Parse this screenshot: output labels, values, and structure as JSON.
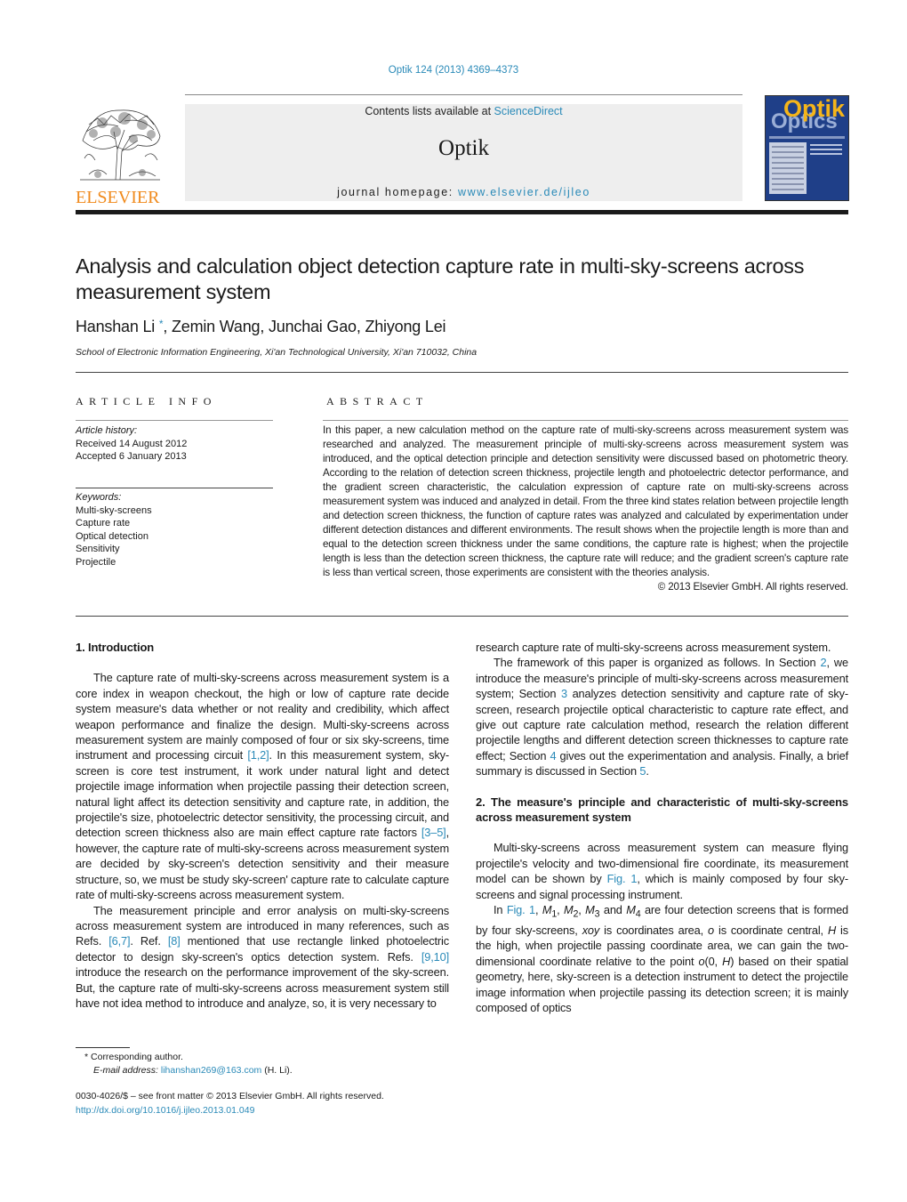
{
  "header": {
    "citation": "Optik 124 (2013) 4369–4373",
    "contents_prefix": "Contents lists available at ",
    "contents_link": "ScienceDirect",
    "journal_name": "Optik",
    "homepage_prefix": "journal homepage: ",
    "homepage_link": "www.elsevier.de/ijleo",
    "publisher_logo_text": "ELSEVIER",
    "cover_title_top": "Optik",
    "cover_title_bottom": "Optics"
  },
  "article": {
    "title": "Analysis and calculation object detection capture rate in multi-sky-screens across measurement system",
    "authors": [
      {
        "name": "Hanshan Li",
        "corresponding_mark": "*"
      },
      {
        "name": "Zemin Wang"
      },
      {
        "name": "Junchai Gao"
      },
      {
        "name": "Zhiyong Lei"
      }
    ],
    "affiliation": "School of Electronic Information Engineering, Xi'an Technological University, Xi'an 710032, China"
  },
  "article_info": {
    "heading": "ARTICLE INFO",
    "history_label": "Article history:",
    "received": "Received 14 August 2012",
    "accepted": "Accepted 6 January 2013",
    "keywords_label": "Keywords:",
    "keywords": [
      "Multi-sky-screens",
      "Capture rate",
      "Optical detection",
      "Sensitivity",
      "Projectile"
    ]
  },
  "abstract": {
    "heading": "ABSTRACT",
    "text": "In this paper, a new calculation method on the capture rate of multi-sky-screens across measurement system was researched and analyzed. The measurement principle of multi-sky-screens across measurement system was introduced, and the optical detection principle and detection sensitivity were discussed based on photometric theory. According to the relation of detection screen thickness, projectile length and photoelectric detector performance, and the gradient screen characteristic, the calculation expression of capture rate on multi-sky-screens across measurement system was induced and analyzed in detail. From the three kind states relation between projectile length and detection screen thickness, the function of capture rates was analyzed and calculated by experimentation under different detection distances and different environments. The result shows when the projectile length is more than and equal to the detection screen thickness under the same conditions, the capture rate is highest; when the projectile length is less than the detection screen thickness, the capture rate will reduce; and the gradient screen's capture rate is less than vertical screen, those experiments are consistent with the theories analysis.",
    "copyright": "© 2013 Elsevier GmbH. All rights reserved."
  },
  "body": {
    "sec1_heading": "1.  Introduction",
    "p1_a": "The capture rate of multi-sky-screens across measurement system is a core index in weapon checkout, the high or low of capture rate decide system measure's data whether or not reality and credibility, which affect weapon performance and finalize the design. Multi-sky-screens across measurement system are mainly composed of four or six sky-screens, time instrument and processing circuit ",
    "p1_ref1": "[1,2]",
    "p1_b": ". In this measurement system, sky-screen is core test instrument, it work under natural light and detect projectile image information when projectile passing their detection screen, natural light affect its detection sensitivity and capture rate, in addition, the projectile's size, photoelectric detector sensitivity, the processing circuit, and detection screen thickness also are main effect capture rate factors ",
    "p1_ref2": "[3–5]",
    "p1_c": ", however, the capture rate of multi-sky-screens across measurement system are decided by sky-screen's detection sensitivity and their measure structure, so, we must be study sky-screen' capture rate to calculate capture rate of multi-sky-screens across measurement system.",
    "p2_a": "The measurement principle and error analysis on multi-sky-screens across measurement system are introduced in many references, such as Refs. ",
    "p2_ref1": "[6,7]",
    "p2_b": ". Ref. ",
    "p2_ref2": "[8]",
    "p2_c": " mentioned that use rectangle linked photoelectric detector to design sky-screen's optics detection system. Refs. ",
    "p2_ref3": "[9,10]",
    "p2_d": " introduce the research on the performance improvement of the sky-screen. But, the capture rate of multi-sky-screens across measurement system still have not idea method to introduce and analyze, so, it is very necessary to research capture rate of multi-sky-screens across measurement system.",
    "p3_a": "The framework of this paper is organized as follows. In Section ",
    "p3_ref1": "2",
    "p3_b": ", we introduce the measure's principle of multi-sky-screens across measurement system; Section ",
    "p3_ref2": "3",
    "p3_c": " analyzes detection sensitivity and capture rate of sky-screen, research projectile optical characteristic to capture rate effect, and give out capture rate calculation method, research the relation different projectile lengths and different detection screen thicknesses to capture rate effect; Section ",
    "p3_ref3": "4",
    "p3_d": " gives out the experimentation and analysis. Finally, a brief summary is discussed in Section ",
    "p3_ref4": "5",
    "p3_e": ".",
    "sec2_heading": "2.  The measure's principle and characteristic of multi-sky-screens across measurement system",
    "p4_a": "Multi-sky-screens across measurement system can measure flying projectile's velocity and two-dimensional fire coordinate, its measurement model can be shown by ",
    "p4_ref": "Fig. 1",
    "p4_b": ", which is mainly composed by four sky-screens and signal processing instrument.",
    "p5_a": "In ",
    "p5_ref": "Fig. 1",
    "p5_b": ", ",
    "m1": "M",
    "s1": "1",
    "m2": "M",
    "s2": "2",
    "m3": "M",
    "s3": "3",
    "m4": "M",
    "s4": "4",
    "p5_c": " and ",
    "p5_d": " are four detection screens that is formed by four sky-screens, ",
    "xoy": "xoy",
    "p5_e": " is coordinates area, ",
    "o1": "o",
    "p5_f": " is coordinate central, ",
    "h1": "H",
    "p5_g": " is the high, when projectile passing coordinate area, we can gain the two-dimensional coordinate relative to the point ",
    "o2": "o",
    "p5_h": "(0, ",
    "h2": "H",
    "p5_i": ") based on their spatial geometry, here, sky-screen is a detection instrument to detect the projectile image information when projectile passing its detection screen; it is mainly composed of optics"
  },
  "footer": {
    "footnote_mark": "*",
    "corresponding": "Corresponding author.",
    "email_label": "E-mail address:",
    "email": "lihanshan269@163.com",
    "email_suffix": " (H. Li).",
    "front_matter": "0030-4026/$ – see front matter © 2013 Elsevier GmbH. All rights reserved.",
    "doi": "http://dx.doi.org/10.1016/j.ijleo.2013.01.049"
  }
}
